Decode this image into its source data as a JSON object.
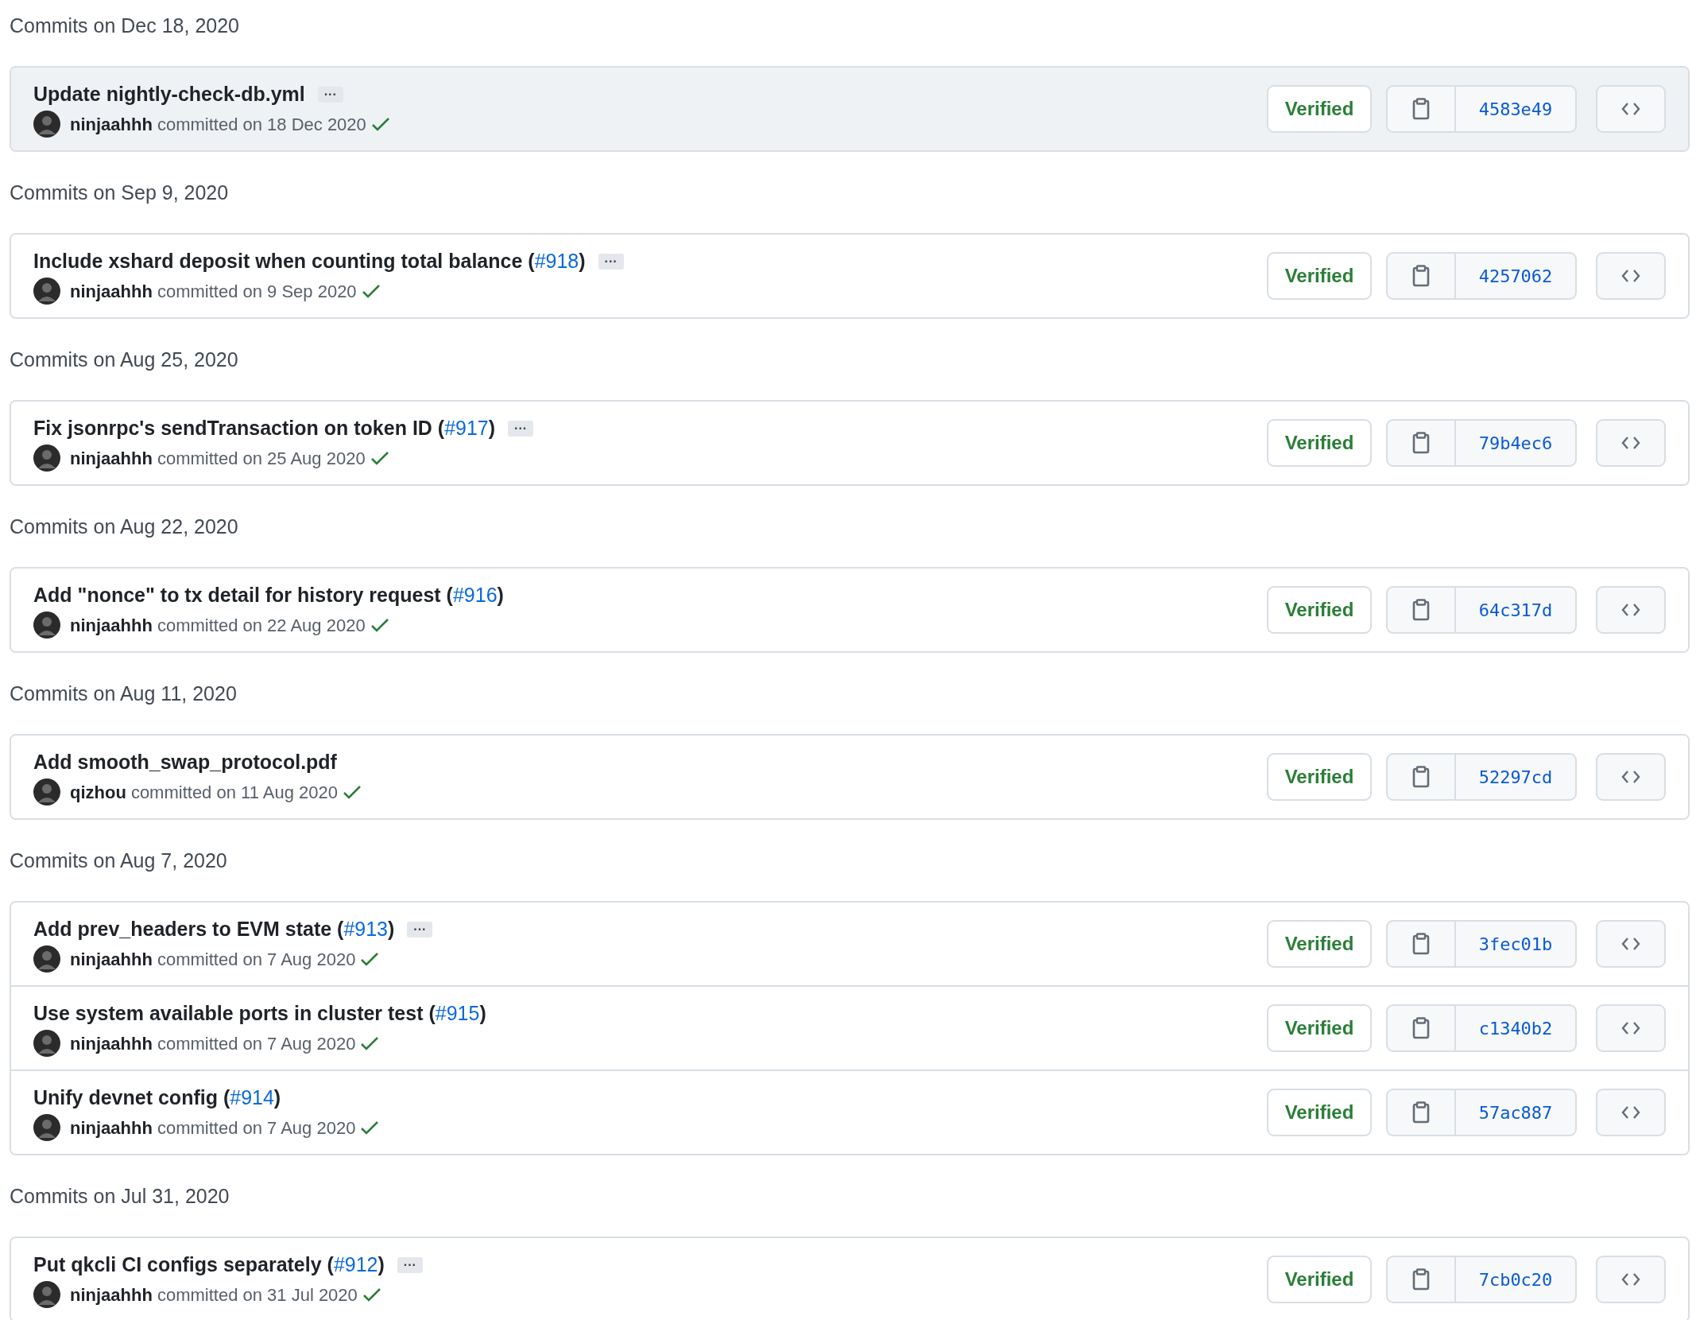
{
  "groups": [
    {
      "heading": "Commits on Dec 18, 2020",
      "commits": [
        {
          "title": "Update nightly-check-db.yml",
          "expander": "···",
          "author": "ninjaahhh",
          "committed": "committed on 18 Dec 2020",
          "checks_passed": true,
          "verified": "Verified",
          "sha": "4583e49",
          "highlighted": true
        }
      ]
    },
    {
      "heading": "Commits on Sep 9, 2020",
      "commits": [
        {
          "title": "Include xshard deposit when counting total balance (",
          "pr": "#918",
          "title_end": ")",
          "expander": "···",
          "author": "ninjaahhh",
          "committed": "committed on 9 Sep 2020",
          "checks_passed": true,
          "verified": "Verified",
          "sha": "4257062",
          "highlighted": false
        }
      ]
    },
    {
      "heading": "Commits on Aug 25, 2020",
      "commits": [
        {
          "title": "Fix jsonrpc's sendTransaction on token ID (",
          "pr": "#917",
          "title_end": ")",
          "expander": "···",
          "author": "ninjaahhh",
          "committed": "committed on 25 Aug 2020",
          "checks_passed": true,
          "verified": "Verified",
          "sha": "79b4ec6",
          "highlighted": false
        }
      ]
    },
    {
      "heading": "Commits on Aug 22, 2020",
      "commits": [
        {
          "title": "Add \"nonce\" to tx detail for history request (",
          "pr": "#916",
          "title_end": ")",
          "author": "ninjaahhh",
          "committed": "committed on 22 Aug 2020",
          "checks_passed": true,
          "verified": "Verified",
          "sha": "64c317d",
          "highlighted": false
        }
      ]
    },
    {
      "heading": "Commits on Aug 11, 2020",
      "commits": [
        {
          "title": "Add smooth_swap_protocol.pdf",
          "author": "qizhou",
          "committed": "committed on 11 Aug 2020",
          "checks_passed": true,
          "verified": "Verified",
          "sha": "52297cd",
          "highlighted": false
        }
      ]
    },
    {
      "heading": "Commits on Aug 7, 2020",
      "commits": [
        {
          "title": "Add prev_headers to EVM state (",
          "pr": "#913",
          "title_end": ")",
          "expander": "···",
          "author": "ninjaahhh",
          "committed": "committed on 7 Aug 2020",
          "checks_passed": true,
          "verified": "Verified",
          "sha": "3fec01b",
          "highlighted": false
        },
        {
          "title": "Use system available ports in cluster test (",
          "pr": "#915",
          "title_end": ")",
          "author": "ninjaahhh",
          "committed": "committed on 7 Aug 2020",
          "checks_passed": true,
          "verified": "Verified",
          "sha": "c1340b2",
          "highlighted": false
        },
        {
          "title": "Unify devnet config (",
          "pr": "#914",
          "title_end": ")",
          "author": "ninjaahhh",
          "committed": "committed on 7 Aug 2020",
          "checks_passed": true,
          "verified": "Verified",
          "sha": "57ac887",
          "highlighted": false
        }
      ]
    },
    {
      "heading": "Commits on Jul 31, 2020",
      "commits": [
        {
          "title": "Put qkcli CI configs separately (",
          "pr": "#912",
          "title_end": ")",
          "expander": "···",
          "author": "ninjaahhh",
          "committed": "committed on 31 Jul 2020",
          "checks_passed": true,
          "verified": "Verified",
          "sha": "7cb0c20",
          "highlighted": false
        }
      ]
    }
  ]
}
